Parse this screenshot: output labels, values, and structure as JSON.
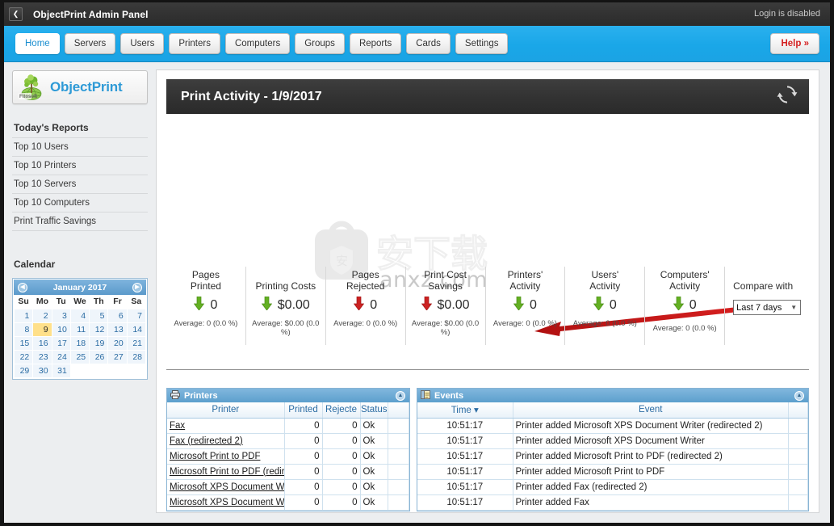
{
  "titlebar": {
    "back_icon": "chevron-left-icon",
    "title": "ObjectPrint Admin Panel",
    "login_status": "Login is disabled"
  },
  "nav": {
    "tabs": [
      {
        "label": "Home",
        "active": true
      },
      {
        "label": "Servers",
        "active": false
      },
      {
        "label": "Users",
        "active": false
      },
      {
        "label": "Printers",
        "active": false
      },
      {
        "label": "Computers",
        "active": false
      },
      {
        "label": "Groups",
        "active": false
      },
      {
        "label": "Reports",
        "active": false
      },
      {
        "label": "Cards",
        "active": false
      },
      {
        "label": "Settings",
        "active": false
      }
    ],
    "help_label": "Help »"
  },
  "sidebar": {
    "logo_vendor": "Fitosoft",
    "logo_text": "ObjectPrint",
    "reports_heading": "Today's Reports",
    "report_items": [
      {
        "label": "Top 10 Users"
      },
      {
        "label": "Top 10 Printers"
      },
      {
        "label": "Top 10 Servers"
      },
      {
        "label": "Top 10 Computers"
      },
      {
        "label": "Print Traffic Savings"
      }
    ],
    "calendar_heading": "Calendar",
    "calendar": {
      "month_label": "January 2017",
      "prev_icon": "caret-left-icon",
      "next_icon": "caret-right-icon",
      "weekdays": [
        "Su",
        "Mo",
        "Tu",
        "We",
        "Th",
        "Fr",
        "Sa"
      ],
      "lead_blanks": 0,
      "days": [
        1,
        2,
        3,
        4,
        5,
        6,
        7,
        8,
        9,
        10,
        11,
        12,
        13,
        14,
        15,
        16,
        17,
        18,
        19,
        20,
        21,
        22,
        23,
        24,
        25,
        26,
        27,
        28,
        29,
        30,
        31
      ],
      "selected_day": 9
    }
  },
  "activity": {
    "header_title": "Print Activity - 1/9/2017",
    "refresh_icon": "refresh-icon",
    "stats": [
      {
        "label_line1": "Pages",
        "label_line2": "Printed",
        "value": "0",
        "average": "Average: 0 (0.0 %)",
        "trend": "down",
        "trend_color": "#55aa22"
      },
      {
        "label_line1": "Printing Costs",
        "label_line2": "",
        "value": "$0.00",
        "average": "Average: $0.00 (0.0 %)",
        "trend": "down",
        "trend_color": "#55aa22"
      },
      {
        "label_line1": "Pages",
        "label_line2": "Rejected",
        "value": "0",
        "average": "Average: 0 (0.0 %)",
        "trend": "down",
        "trend_color": "#cc2222"
      },
      {
        "label_line1": "Print Cost",
        "label_line2": "Savings",
        "value": "$0.00",
        "average": "Average: $0.00 (0.0 %)",
        "trend": "down",
        "trend_color": "#cc2222"
      },
      {
        "label_line1": "Printers'",
        "label_line2": "Activity",
        "value": "0",
        "average": "Average: 0 (0.0 %)",
        "trend": "down",
        "trend_color": "#55aa22"
      },
      {
        "label_line1": "Users'",
        "label_line2": "Activity",
        "value": "0",
        "average": "Average: 0 (0.0 %)",
        "trend": "down",
        "trend_color": "#55aa22"
      },
      {
        "label_line1": "Computers'",
        "label_line2": "Activity",
        "value": "0",
        "average": "Average: 0 (0.0 %)",
        "trend": "down",
        "trend_color": "#55aa22"
      }
    ],
    "compare_label": "Compare with",
    "compare_value": "Last 7 days",
    "compare_caret": "chevron-down-icon"
  },
  "watermark": {
    "text": "anxz.com",
    "cn_text": "安下载"
  },
  "printers_grid": {
    "title": "Printers",
    "icon": "printer-icon",
    "collapse_icon": "collapse-icon",
    "columns": [
      "Printer",
      "Printed",
      "Rejecte",
      "Status",
      ""
    ],
    "rows": [
      {
        "printer": "Fax",
        "printed": "0",
        "rejected": "0",
        "status": "Ok"
      },
      {
        "printer": "Fax (redirected 2)",
        "printed": "0",
        "rejected": "0",
        "status": "Ok"
      },
      {
        "printer": "Microsoft Print to PDF",
        "printed": "0",
        "rejected": "0",
        "status": "Ok"
      },
      {
        "printer": "Microsoft Print to PDF (redirec",
        "printed": "0",
        "rejected": "0",
        "status": "Ok"
      },
      {
        "printer": "Microsoft XPS Document Write",
        "printed": "0",
        "rejected": "0",
        "status": "Ok"
      },
      {
        "printer": "Microsoft XPS Document Write",
        "printed": "0",
        "rejected": "0",
        "status": "Ok"
      }
    ]
  },
  "events_grid": {
    "title": "Events",
    "icon": "event-log-icon",
    "collapse_icon": "collapse-icon",
    "columns": [
      "Time",
      "Event",
      ""
    ],
    "sort_indicator": "▾",
    "rows": [
      {
        "time": "10:51:17",
        "event": "Printer added Microsoft XPS Document Writer (redirected 2)"
      },
      {
        "time": "10:51:17",
        "event": "Printer added Microsoft XPS Document Writer"
      },
      {
        "time": "10:51:17",
        "event": "Printer added Microsoft Print to PDF (redirected 2)"
      },
      {
        "time": "10:51:17",
        "event": "Printer added Microsoft Print to PDF"
      },
      {
        "time": "10:51:17",
        "event": "Printer added Fax (redirected 2)"
      },
      {
        "time": "10:51:17",
        "event": "Printer added Fax"
      }
    ]
  },
  "colors": {
    "nav_blue": "#1aa7e8",
    "titlebar_dark": "#333333",
    "accent_logo": "#2e9ad6",
    "help_red": "#d41f1f",
    "grid_header_blue": "#5c9fcd",
    "arrow_red": "#cc1111",
    "calendar_selected": "#ffe08a"
  }
}
